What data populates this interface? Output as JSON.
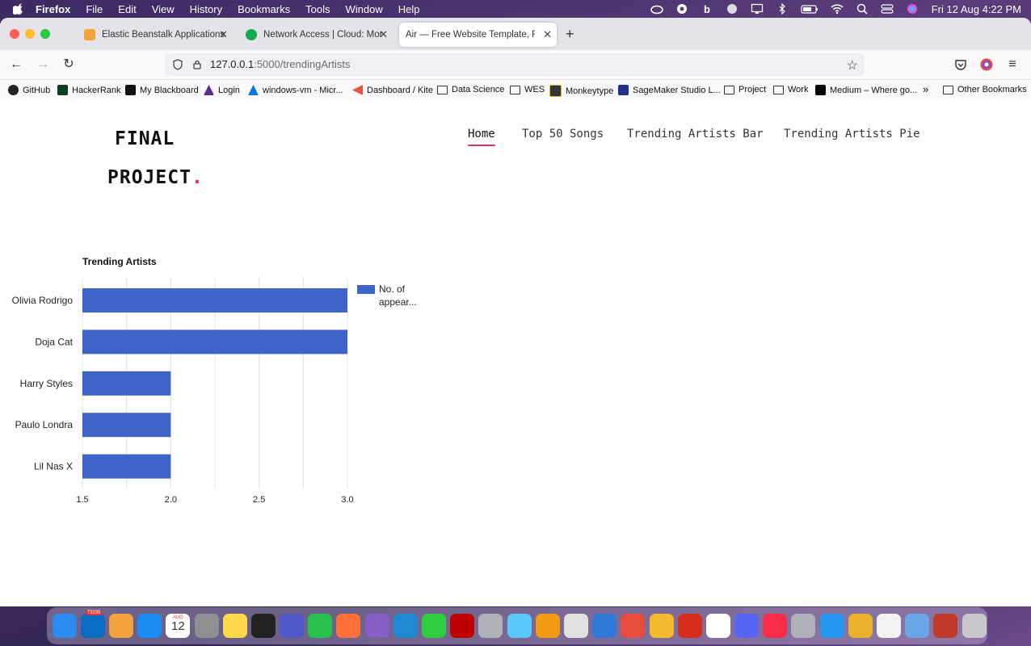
{
  "menubar": {
    "app_name": "Firefox",
    "items": [
      "File",
      "Edit",
      "View",
      "History",
      "Bookmarks",
      "Tools",
      "Window",
      "Help"
    ],
    "clock": "Fri 12 Aug  4:22 PM"
  },
  "tabs": [
    {
      "title": "Elastic Beanstalk Applications",
      "favicon_color": "#f0a53b"
    },
    {
      "title": "Network Access | Cloud: Mongo",
      "favicon_color": "#13aa52"
    },
    {
      "title": "Air — Free Website Template, Free H",
      "favicon_color": "#ffffff"
    }
  ],
  "address_bar": {
    "host": "127.0.0.1",
    "path": ":5000/trendingArtists"
  },
  "bookmarks": [
    {
      "label": "GitHub",
      "color": "#222222"
    },
    {
      "label": "HackerRank",
      "color": "#1ba94c"
    },
    {
      "label": "My Blackboard",
      "color": "#111111"
    },
    {
      "label": "Login",
      "color": "#5b2c8f"
    },
    {
      "label": "windows-vm - Micr...",
      "color": "#0a78d4"
    },
    {
      "label": "Dashboard / Kite",
      "color": "#e8543c"
    },
    {
      "label": "Data Science",
      "color": "folder"
    },
    {
      "label": "WES",
      "color": "folder"
    },
    {
      "label": "Monkeytype",
      "color": "#e2b714"
    },
    {
      "label": "SageMaker Studio L...",
      "color": "#232f8e"
    },
    {
      "label": "Project",
      "color": "folder"
    },
    {
      "label": "Work",
      "color": "folder"
    },
    {
      "label": "Medium – Where go...",
      "color": "#000000"
    }
  ],
  "other_bookmarks": "Other Bookmarks",
  "site": {
    "logo_line1": "FINAL",
    "logo_line2": "PROJECT",
    "logo_dot": ".",
    "nav": [
      "Home",
      "Top 50 Songs",
      "Trending Artists Bar",
      "Trending Artists Pie"
    ],
    "active_nav": "Home",
    "accent": "#e3305c"
  },
  "chart_data": {
    "type": "bar",
    "orientation": "horizontal",
    "title": "Trending Artists",
    "categories": [
      "Olivia Rodrigo",
      "Doja Cat",
      "Harry Styles",
      "Paulo Londra",
      "Lil Nas X"
    ],
    "series": [
      {
        "name": "No. of appear...",
        "values": [
          3,
          3,
          2,
          2,
          2
        ],
        "color": "#3f64c8"
      }
    ],
    "xlim": [
      1.5,
      3.0
    ],
    "xticks": [
      "1.5",
      "2.0",
      "2.5",
      "3.0"
    ],
    "grid": true,
    "legend": "right"
  },
  "dock": {
    "apps": [
      "finder",
      "outlook",
      "photos",
      "app-store",
      "calendar",
      "settings",
      "notes",
      "terminal",
      "teams",
      "whatsapp",
      "firefox",
      "visual-studio",
      "vscode",
      "activity",
      "filezilla",
      "help",
      "textedit",
      "pages",
      "launchpad",
      "xcode",
      "remote-desktop",
      "binance",
      "parallels",
      "chrome",
      "discord",
      "music",
      "help",
      "docker",
      "slack",
      "reminders",
      "preview",
      "acrobat",
      "trash"
    ],
    "colors": [
      "#2a8cf0",
      "#0b6cc4",
      "#f2a340",
      "#1b8df0",
      "#ffffff",
      "#8e8e93",
      "#ffd84d",
      "#222222",
      "#5059c9",
      "#29c14d",
      "#ff7139",
      "#865fc5",
      "#1f8ad2",
      "#2ecc40",
      "#bf0000",
      "#b0b0b8",
      "#5ac8fa",
      "#f39c12",
      "#e0e0e0",
      "#2f7ad8",
      "#e74c3c",
      "#f3ba2f",
      "#d62d20",
      "#ffffff",
      "#5865f2",
      "#fa2d48",
      "#b0b0b8",
      "#2496ed",
      "#ecb22e",
      "#f2f2f2",
      "#6aa7e8",
      "#c0392b",
      "#c8c8cc"
    ],
    "calendar_month": "AUG",
    "calendar_day": "12",
    "mail_badge": "73235"
  }
}
